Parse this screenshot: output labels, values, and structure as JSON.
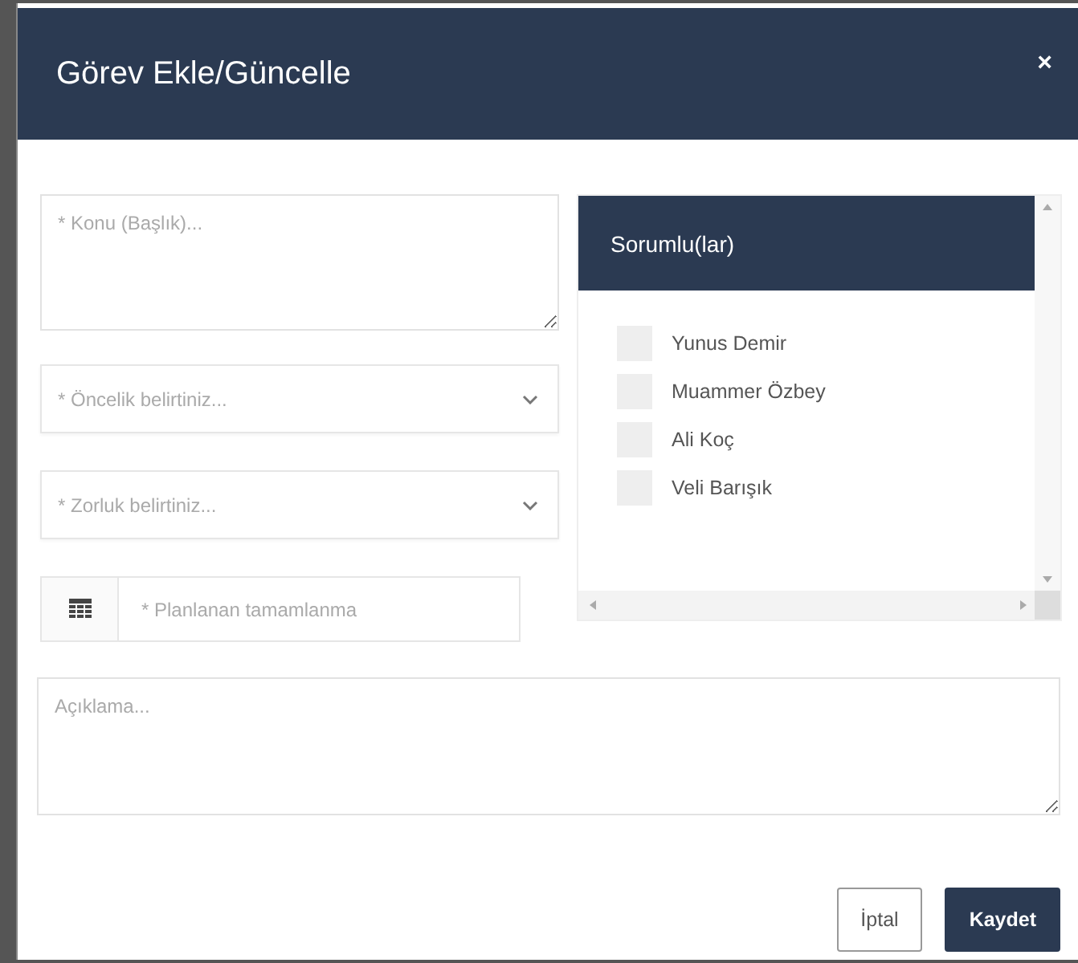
{
  "dialog": {
    "title": "Görev Ekle/Güncelle",
    "close": "×"
  },
  "subject": {
    "placeholder": "* Konu (Başlık)..."
  },
  "selects": [
    {
      "placeholder": "* Öncelik belirtiniz..."
    },
    {
      "placeholder": "* Zorluk belirtiniz..."
    }
  ],
  "date": {
    "placeholder": "* Planlanan tamamlanma"
  },
  "responsibles": {
    "title": "Sorumlu(lar)",
    "people": [
      {
        "name": "Yunus Demir",
        "checked": false
      },
      {
        "name": "Muammer Özbey",
        "checked": false
      },
      {
        "name": "Ali Koç",
        "checked": false
      },
      {
        "name": "Veli Barışık",
        "checked": false
      }
    ]
  },
  "description": {
    "placeholder": "Açıklama..."
  },
  "buttons": [
    {
      "label": "İptal",
      "kind": "secondary"
    },
    {
      "label": "Kaydet",
      "kind": "primary"
    }
  ]
}
